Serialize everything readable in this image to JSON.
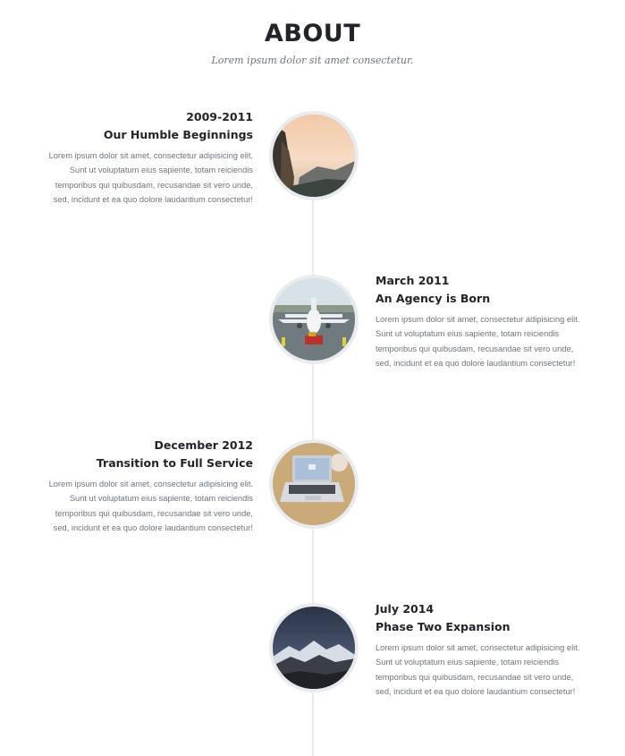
{
  "header": {
    "title": "ABOUT",
    "subtitle": "Lorem ipsum dolor sit amet consectetur."
  },
  "timeline": [
    {
      "date": "2009-2011",
      "heading": "Our Humble Beginnings",
      "text": "Lorem ipsum dolor sit amet, consectetur adipisicing elit. Sunt ut voluptatum eius sapiente, totam reiciendis temporibus qui quibusdam, recusandae sit vero unde, sed, incidunt et ea quo dolore laudantium consectetur!",
      "side": "left",
      "image": "mountain-canyon"
    },
    {
      "date": "March 2011",
      "heading": "An Agency is Born",
      "text": "Lorem ipsum dolor sit amet, consectetur adipisicing elit. Sunt ut voluptatum eius sapiente, totam reiciendis temporibus qui quibusdam, recusandae sit vero unde, sed, incidunt et ea quo dolore laudantium consectetur!",
      "side": "right",
      "image": "airplane"
    },
    {
      "date": "December 2012",
      "heading": "Transition to Full Service",
      "text": "Lorem ipsum dolor sit amet, consectetur adipisicing elit. Sunt ut voluptatum eius sapiente, totam reiciendis temporibus qui quibusdam, recusandae sit vero unde, sed, incidunt et ea quo dolore laudantium consectetur!",
      "side": "left",
      "image": "laptop"
    },
    {
      "date": "July 2014",
      "heading": "Phase Two Expansion",
      "text": "Lorem ipsum dolor sit amet, consectetur adipisicing elit. Sunt ut voluptatum eius sapiente, totam reiciendis temporibus qui quibusdam, recusandae sit vero unde, sed, incidunt et ea quo dolore laudantium consectetur!",
      "side": "right",
      "image": "snowy-mountains"
    }
  ],
  "colors": {
    "heading": "#212529",
    "muted": "#6c757d",
    "line": "#e9ecef"
  }
}
